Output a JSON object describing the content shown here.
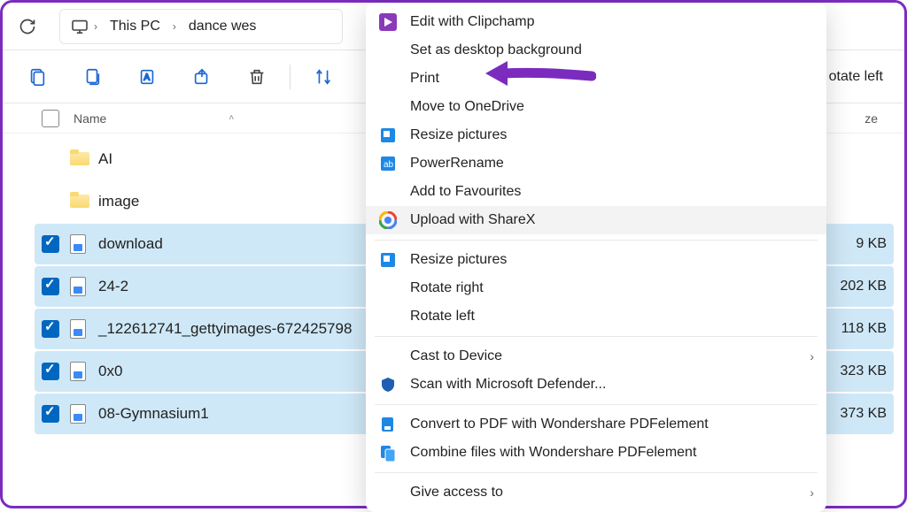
{
  "breadcrumb": {
    "pc": "This PC",
    "folder": "dance wes"
  },
  "toolbar": {
    "rotate_left_partial": "otate left"
  },
  "columns": {
    "name": "Name",
    "size_partial": "ze"
  },
  "files": [
    {
      "name": "AI",
      "type": "folder",
      "selected": false,
      "size": ""
    },
    {
      "name": "image",
      "type": "folder",
      "selected": false,
      "size": ""
    },
    {
      "name": "download",
      "type": "image",
      "selected": true,
      "size": "9 KB"
    },
    {
      "name": "24-2",
      "type": "image",
      "selected": true,
      "size": "202 KB"
    },
    {
      "name": "_122612741_gettyimages-672425798",
      "type": "image",
      "selected": true,
      "size": "118 KB"
    },
    {
      "name": "0x0",
      "type": "image",
      "selected": true,
      "size": "323 KB"
    },
    {
      "name": "08-Gymnasium1",
      "type": "image",
      "selected": true,
      "size": "373 KB"
    }
  ],
  "context_menu": {
    "items": [
      {
        "label": "Edit with Clipchamp",
        "icon": "clipchamp",
        "sep": false
      },
      {
        "label": "Set as desktop background",
        "icon": "",
        "sep": false
      },
      {
        "label": "Print",
        "icon": "",
        "sep": false
      },
      {
        "label": "Move to OneDrive",
        "icon": "",
        "sep": false
      },
      {
        "label": "Resize pictures",
        "icon": "resize-blue",
        "sep": false
      },
      {
        "label": "PowerRename",
        "icon": "rename-blue",
        "sep": false
      },
      {
        "label": "Add to Favourites",
        "icon": "",
        "sep": false
      },
      {
        "label": "Upload with ShareX",
        "icon": "sharex",
        "highlight": true,
        "sep": false
      },
      {
        "sep": true
      },
      {
        "label": "Resize pictures",
        "icon": "resize-blue",
        "sep": false
      },
      {
        "label": "Rotate right",
        "icon": "",
        "sep": false
      },
      {
        "label": "Rotate left",
        "icon": "",
        "sep": false
      },
      {
        "sep": true
      },
      {
        "label": "Cast to Device",
        "icon": "",
        "submenu": true,
        "sep": false
      },
      {
        "label": "Scan with Microsoft Defender...",
        "icon": "shield",
        "sep": false
      },
      {
        "sep": true
      },
      {
        "label": "Convert to PDF with Wondershare PDFelement",
        "icon": "pdf-blue",
        "sep": false
      },
      {
        "label": "Combine files with Wondershare PDFelement",
        "icon": "pdf-combine",
        "sep": false
      },
      {
        "sep": true
      },
      {
        "label": "Give access to",
        "icon": "",
        "submenu": true,
        "sep": false
      }
    ]
  }
}
